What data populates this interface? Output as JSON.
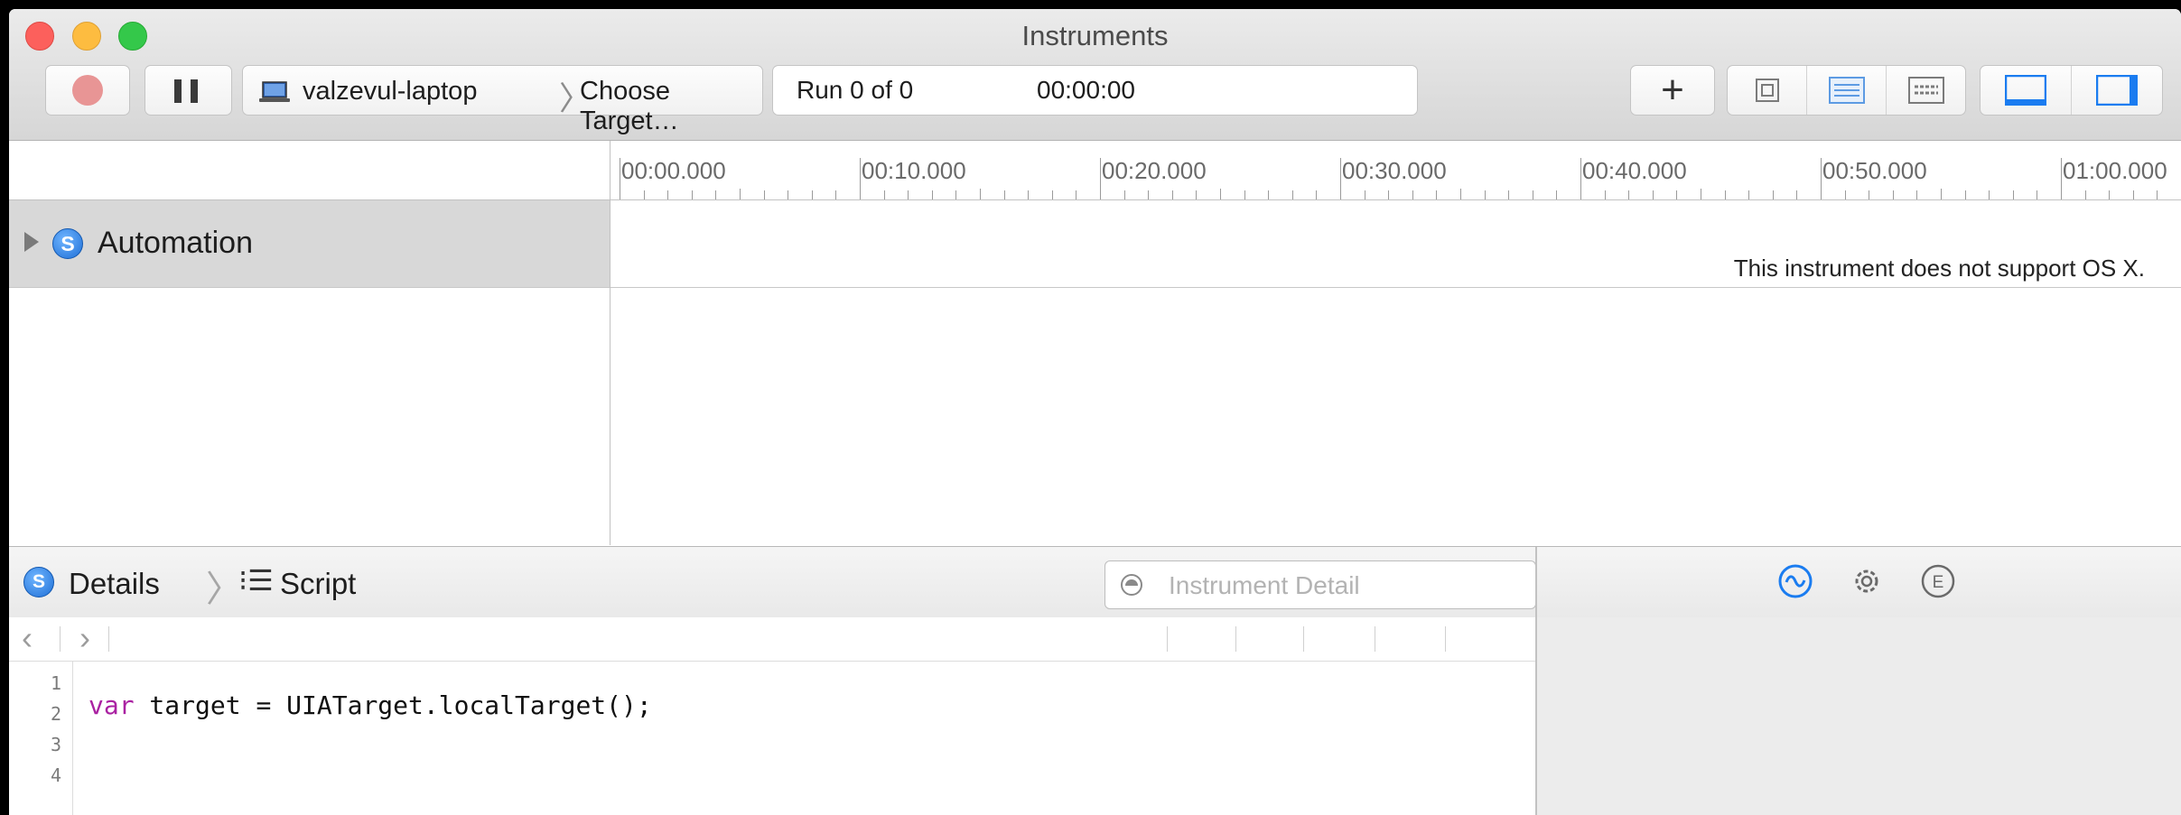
{
  "window": {
    "title": "Instruments"
  },
  "toolbar": {
    "target_device": "valzevul-laptop",
    "target_choose": "Choose Target…",
    "run_status": "Run 0 of 0",
    "run_time": "00:00:00",
    "add_label": "+"
  },
  "timeline": {
    "ticks": [
      "00:00.000",
      "00:10.000",
      "00:20.000",
      "00:30.000",
      "00:40.000",
      "00:50.000",
      "01:00.000"
    ]
  },
  "tracks": [
    {
      "name": "Automation",
      "message": "This instrument does not support OS X."
    }
  ],
  "detail_bar": {
    "details_label": "Details",
    "script_label": "Script",
    "search_placeholder": "Instrument Detail"
  },
  "editor": {
    "line_numbers": [
      "1",
      "2",
      "3",
      "4"
    ],
    "keyword": "var",
    "code_rest": " target = UIATarget.localTarget();"
  },
  "colors": {
    "accent": "#1a7cf0",
    "record": "#e89595",
    "keyword": "#aa22a2"
  }
}
